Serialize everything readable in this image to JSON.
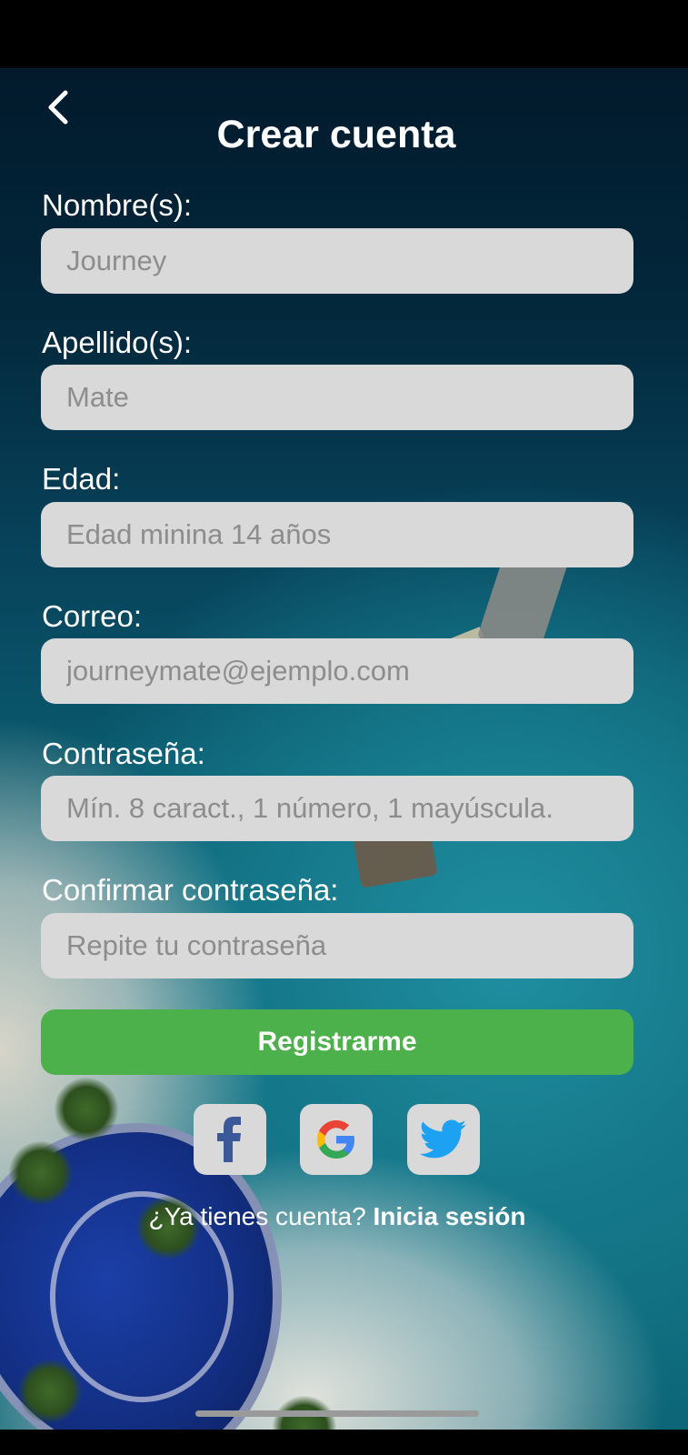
{
  "header": {
    "title": "Crear cuenta",
    "back_icon": "chevron-left-icon"
  },
  "form": {
    "fields": [
      {
        "label": "Nombre(s):",
        "placeholder": "Journey",
        "value": ""
      },
      {
        "label": "Apellido(s):",
        "placeholder": "Mate",
        "value": ""
      },
      {
        "label": "Edad:",
        "placeholder": "Edad minina 14 años",
        "value": ""
      },
      {
        "label": "Correo:",
        "placeholder": "journeymate@ejemplo.com",
        "value": ""
      },
      {
        "label": "Contraseña:",
        "placeholder": "Mín. 8 caract., 1 número, 1 mayúscula.",
        "value": ""
      },
      {
        "label": "Confirmar contraseña:",
        "placeholder": "Repite tu contraseña",
        "value": ""
      }
    ],
    "submit_label": "Registrarme"
  },
  "social": [
    {
      "name": "facebook",
      "icon": "facebook-icon",
      "color": "#3b5998"
    },
    {
      "name": "google",
      "icon": "google-icon",
      "color": "#4285F4"
    },
    {
      "name": "twitter",
      "icon": "twitter-icon",
      "color": "#1DA1F2"
    }
  ],
  "footer": {
    "prompt": "¿Ya tienes cuenta? ",
    "link": "Inicia sesión"
  },
  "colors": {
    "accent_green": "#4cb04b",
    "input_bg": "#d9d9d9"
  }
}
